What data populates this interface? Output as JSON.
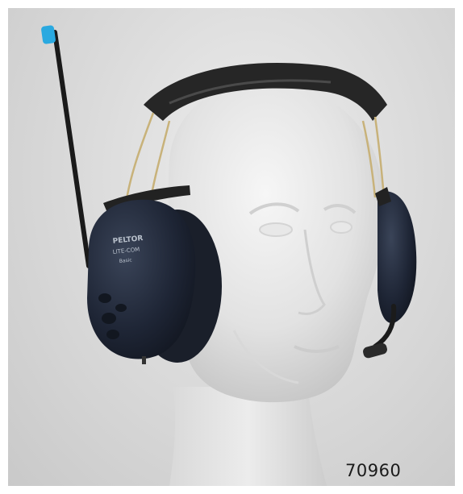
{
  "image": {
    "subject": "Peltor headset on mannequin head",
    "product_code": "70960",
    "earcup_brand": "PELTOR",
    "earcup_model": "LITE-COM",
    "earcup_sub": "Basic"
  },
  "colors": {
    "background": "#d6d6d6",
    "earcup": "#1e2535",
    "headband": "#262626",
    "antenna_tip": "#2aa9e0",
    "mannequin": "#e6e6e6",
    "wire": "#c8b27a"
  }
}
